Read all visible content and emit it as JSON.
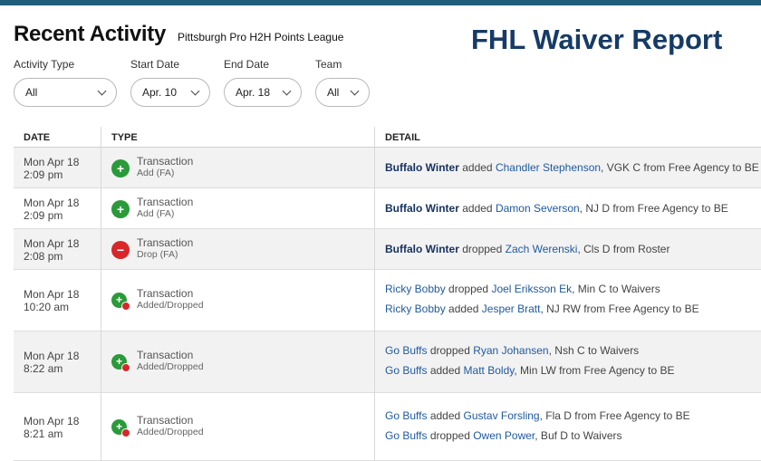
{
  "header": {
    "title": "Recent Activity",
    "league": "Pittsburgh Pro H2H Points League",
    "report_title": "FHL Waiver Report"
  },
  "filters": {
    "activity_type": {
      "label": "Activity Type",
      "value": "All"
    },
    "start_date": {
      "label": "Start Date",
      "value": "Apr. 10"
    },
    "end_date": {
      "label": "End Date",
      "value": "Apr. 18"
    },
    "team": {
      "label": "Team",
      "value": "All"
    }
  },
  "columns": {
    "date": "DATE",
    "type": "TYPE",
    "detail": "DETAIL"
  },
  "rows": [
    {
      "date": "Mon Apr 18",
      "time": "2:09 pm",
      "type": "Transaction",
      "subtype": "Add (FA)",
      "icon": "add-circle-icon",
      "lines": [
        {
          "team": "Buffalo Winter",
          "verb": "added",
          "player": "Chandler Stephenson",
          "rest": ", VGK C from Free Agency to BE"
        }
      ]
    },
    {
      "date": "Mon Apr 18",
      "time": "2:09 pm",
      "type": "Transaction",
      "subtype": "Add (FA)",
      "icon": "add-circle-icon",
      "lines": [
        {
          "team": "Buffalo Winter",
          "verb": "added",
          "player": "Damon Severson",
          "rest": ", NJ D from Free Agency to BE"
        }
      ]
    },
    {
      "date": "Mon Apr 18",
      "time": "2:08 pm",
      "type": "Transaction",
      "subtype": "Drop (FA)",
      "icon": "drop-circle-icon",
      "lines": [
        {
          "team": "Buffalo Winter",
          "verb": "dropped",
          "player": "Zach Werenski",
          "rest": ", Cls D from Roster"
        }
      ]
    },
    {
      "date": "Mon Apr 18",
      "time": "10:20 am",
      "type": "Transaction",
      "subtype": "Added/Dropped",
      "icon": "add-drop-icon",
      "lines": [
        {
          "team": "Ricky Bobby",
          "verb": "dropped",
          "player": "Joel Eriksson Ek",
          "rest": ", Min C to Waivers"
        },
        {
          "team": "Ricky Bobby",
          "verb": "added",
          "player": "Jesper Bratt",
          "rest": ", NJ RW from Free Agency to BE"
        }
      ]
    },
    {
      "date": "Mon Apr 18",
      "time": "8:22 am",
      "type": "Transaction",
      "subtype": "Added/Dropped",
      "icon": "add-drop-icon",
      "lines": [
        {
          "team": "Go Buffs",
          "verb": "dropped",
          "player": "Ryan Johansen",
          "rest": ", Nsh C to Waivers"
        },
        {
          "team": "Go Buffs",
          "verb": "added",
          "player": "Matt Boldy",
          "rest": ", Min LW from Free Agency to BE"
        }
      ]
    },
    {
      "date": "Mon Apr 18",
      "time": "8:21 am",
      "type": "Transaction",
      "subtype": "Added/Dropped",
      "icon": "add-drop-icon",
      "lines": [
        {
          "team": "Go Buffs",
          "verb": "added",
          "player": "Gustav Forsling",
          "rest": ", Fla D from Free Agency to BE"
        },
        {
          "team": "Go Buffs",
          "verb": "dropped",
          "player": "Owen Power",
          "rest": ", Buf D to Waivers"
        }
      ]
    }
  ]
}
